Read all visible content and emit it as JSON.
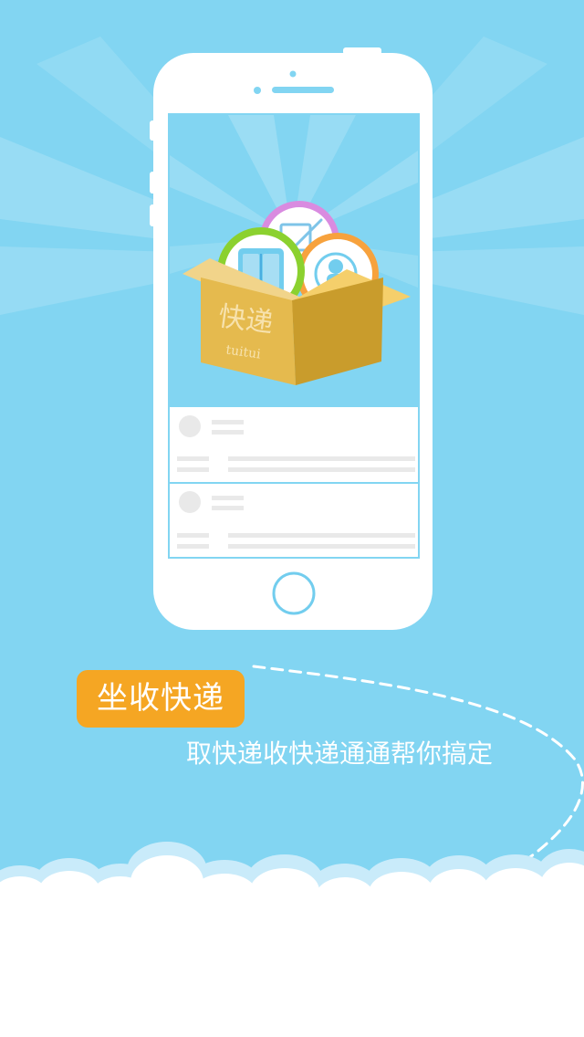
{
  "splash": {
    "headline": "坐收快递",
    "subheadline": "取快递收快递通通帮你搞定"
  },
  "illustration": {
    "box_label": "快递",
    "box_sublabel": "tuitui",
    "icons": [
      "pencil-icon",
      "book-icon",
      "person-icon",
      "home-button-icon"
    ]
  },
  "colors": {
    "background": "#82d5f2",
    "accent": "#f5a623",
    "white": "#ffffff"
  }
}
